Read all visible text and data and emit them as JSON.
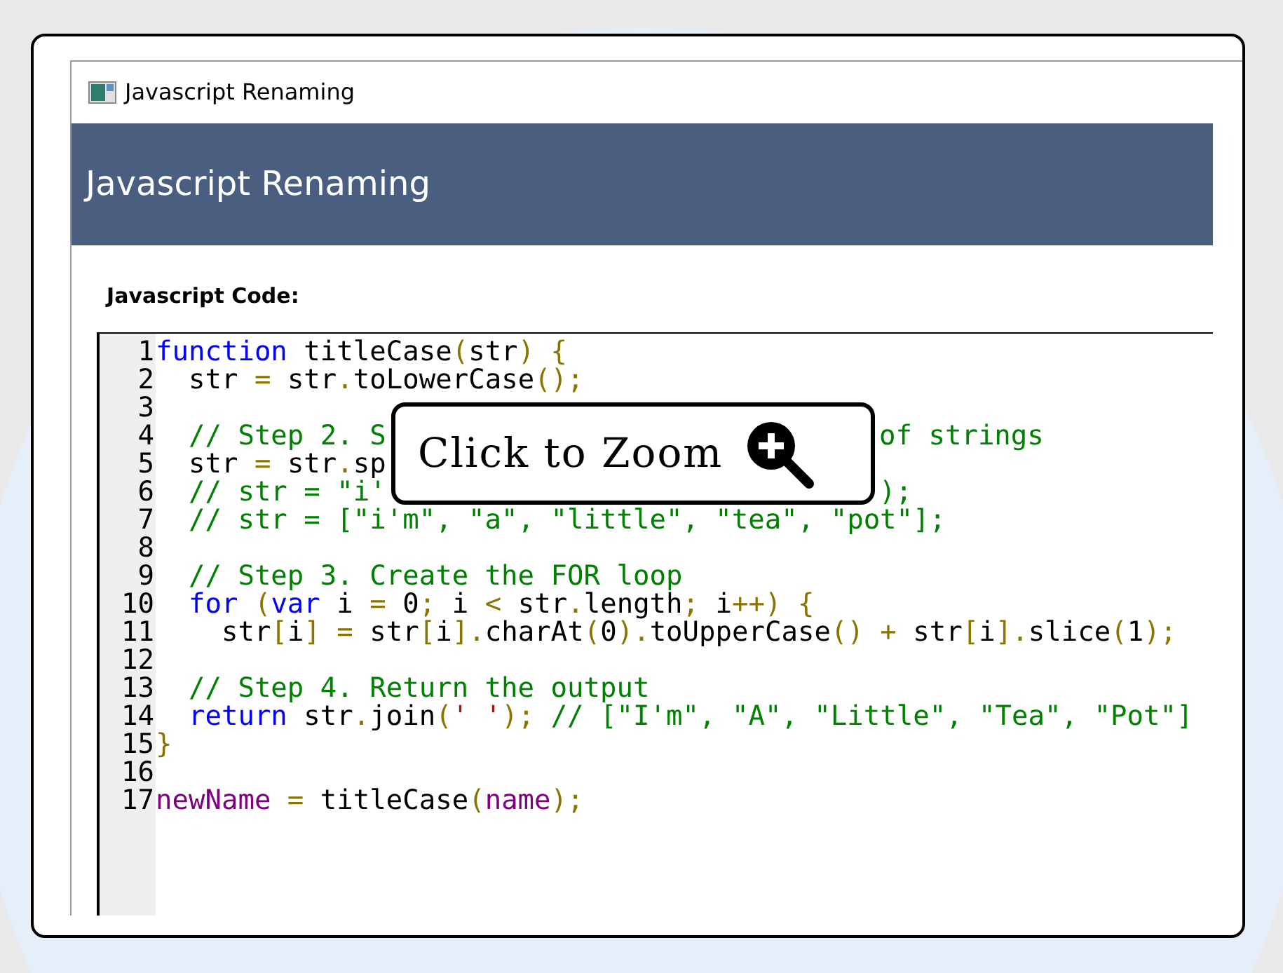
{
  "window": {
    "title": "Javascript Renaming"
  },
  "header": {
    "title": "Javascript Renaming"
  },
  "editor": {
    "label": "Javascript Code:",
    "lines": [
      {
        "number": "1",
        "segments": [
          [
            {
              "kind": "kw",
              "text": "function"
            },
            {
              "kind": "id",
              "text": " titleCase"
            },
            {
              "kind": "punc",
              "text": "("
            },
            {
              "kind": "id",
              "text": "str"
            },
            {
              "kind": "punc",
              "text": ")"
            },
            {
              "kind": "punc",
              "text": " {"
            }
          ]
        ]
      },
      {
        "number": "2",
        "segments": [
          [
            {
              "kind": "id",
              "text": "  str "
            },
            {
              "kind": "punc",
              "text": "="
            },
            {
              "kind": "id",
              "text": " str"
            },
            {
              "kind": "punc",
              "text": "."
            },
            {
              "kind": "id",
              "text": "toLowerCase"
            },
            {
              "kind": "punc",
              "text": "();"
            }
          ]
        ]
      },
      {
        "number": "3"
      },
      {
        "number": "4",
        "segments": [
          [
            {
              "kind": "comment",
              "text": "  // Step 2. S"
            }
          ],
          [
            {
              "kind": "comment",
              "text": "of strings"
            }
          ]
        ]
      },
      {
        "number": "5",
        "segments": [
          [
            {
              "kind": "id",
              "text": "  str "
            },
            {
              "kind": "punc",
              "text": "="
            },
            {
              "kind": "id",
              "text": " str"
            },
            {
              "kind": "punc",
              "text": "."
            },
            {
              "kind": "id",
              "text": "sp"
            }
          ]
        ]
      },
      {
        "number": "6",
        "segments": [
          [
            {
              "kind": "comment",
              "text": "  // str = \"i'"
            }
          ],
          [
            {
              "kind": "comment",
              "text": ");"
            }
          ]
        ]
      },
      {
        "number": "7",
        "segments": [
          [
            {
              "kind": "comment",
              "text": "  // str = [\"i'm\", \"a\", \"little\", \"tea\", \"pot\"];"
            }
          ]
        ]
      },
      {
        "number": "8"
      },
      {
        "number": "9",
        "segments": [
          [
            {
              "kind": "comment",
              "text": "  // Step 3. Create the FOR loop"
            }
          ]
        ]
      },
      {
        "number": "10",
        "segments": [
          [
            {
              "kind": "kw",
              "text": "  for"
            },
            {
              "kind": "punc",
              "text": " ("
            },
            {
              "kind": "kw",
              "text": "var"
            },
            {
              "kind": "id",
              "text": " i "
            },
            {
              "kind": "punc",
              "text": "="
            },
            {
              "kind": "id",
              "text": " 0"
            },
            {
              "kind": "punc",
              "text": ";"
            },
            {
              "kind": "id",
              "text": " i "
            },
            {
              "kind": "punc",
              "text": "<"
            },
            {
              "kind": "id",
              "text": " str"
            },
            {
              "kind": "punc",
              "text": "."
            },
            {
              "kind": "id",
              "text": "length"
            },
            {
              "kind": "punc",
              "text": ";"
            },
            {
              "kind": "id",
              "text": " i"
            },
            {
              "kind": "punc",
              "text": "++)"
            },
            {
              "kind": "punc",
              "text": " {"
            }
          ]
        ]
      },
      {
        "number": "11",
        "segments": [
          [
            {
              "kind": "id",
              "text": "    str"
            },
            {
              "kind": "punc",
              "text": "["
            },
            {
              "kind": "id",
              "text": "i"
            },
            {
              "kind": "punc",
              "text": "]"
            },
            {
              "kind": "punc",
              "text": " ="
            },
            {
              "kind": "id",
              "text": " str"
            },
            {
              "kind": "punc",
              "text": "["
            },
            {
              "kind": "id",
              "text": "i"
            },
            {
              "kind": "punc",
              "text": "]."
            },
            {
              "kind": "id",
              "text": "charAt"
            },
            {
              "kind": "punc",
              "text": "("
            },
            {
              "kind": "id",
              "text": "0"
            },
            {
              "kind": "punc",
              "text": ")."
            },
            {
              "kind": "id",
              "text": "toUpperCase"
            },
            {
              "kind": "punc",
              "text": "()"
            },
            {
              "kind": "punc",
              "text": " +"
            },
            {
              "kind": "id",
              "text": " str"
            },
            {
              "kind": "punc",
              "text": "["
            },
            {
              "kind": "id",
              "text": "i"
            },
            {
              "kind": "punc",
              "text": "]."
            },
            {
              "kind": "id",
              "text": "slice"
            },
            {
              "kind": "punc",
              "text": "("
            },
            {
              "kind": "id",
              "text": "1"
            },
            {
              "kind": "punc",
              "text": ");"
            }
          ]
        ]
      },
      {
        "number": "12"
      },
      {
        "number": "13",
        "segments": [
          [
            {
              "kind": "comment",
              "text": "  // Step 4. Return the output"
            }
          ]
        ]
      },
      {
        "number": "14",
        "segments": [
          [
            {
              "kind": "kw",
              "text": "  return"
            },
            {
              "kind": "id",
              "text": " str"
            },
            {
              "kind": "punc",
              "text": "."
            },
            {
              "kind": "id",
              "text": "join"
            },
            {
              "kind": "punc",
              "text": "("
            },
            {
              "kind": "str",
              "text": "' '"
            },
            {
              "kind": "punc",
              "text": ");"
            },
            {
              "kind": "comment",
              "text": " // [\"I'm\", \"A\", \"Little\", \"Tea\", \"Pot\"]"
            }
          ]
        ]
      },
      {
        "number": "15",
        "segments": [
          [
            {
              "kind": "punc",
              "text": "}"
            }
          ]
        ]
      },
      {
        "number": "16"
      },
      {
        "number": "17",
        "segments": [
          [
            {
              "kind": "var",
              "text": "newName"
            },
            {
              "kind": "punc",
              "text": " ="
            },
            {
              "kind": "id",
              "text": " titleCase"
            },
            {
              "kind": "punc",
              "text": "("
            },
            {
              "kind": "var",
              "text": "name"
            },
            {
              "kind": "punc",
              "text": ");"
            }
          ]
        ]
      }
    ]
  },
  "zoom_overlay": {
    "label": "Click to Zoom"
  }
}
